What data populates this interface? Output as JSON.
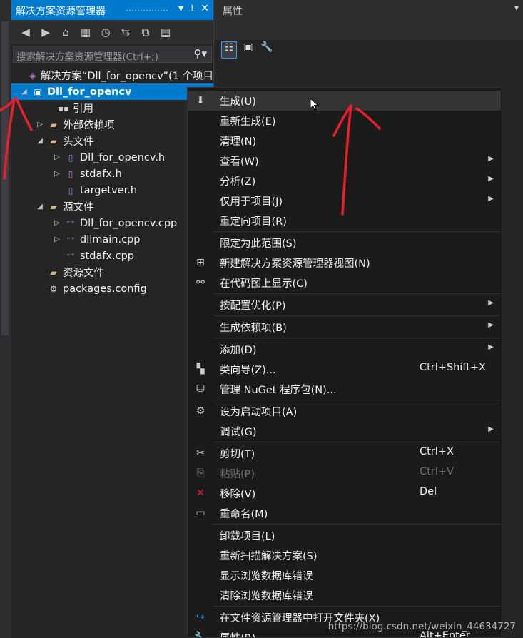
{
  "solution_explorer": {
    "title": "解决方案资源管理器",
    "title_buttons": [
      "▾",
      "⊕",
      "✕"
    ],
    "search_placeholder": "搜索解决方案资源管理器(Ctrl+;)",
    "tree": [
      {
        "label": "解决方案“Dll_for_opencv”(1 个项目",
        "icon": "solution-icon",
        "arrow": ""
      },
      {
        "label": "Dll_for_opencv",
        "icon": "project-icon",
        "arrow": "◢",
        "selected": true
      },
      {
        "label": "引用",
        "icon": "references-icon",
        "arrow": ""
      },
      {
        "label": "外部依赖项",
        "icon": "folder-icon",
        "arrow": "▷"
      },
      {
        "label": "头文件",
        "icon": "folder-icon",
        "arrow": "◢"
      },
      {
        "label": "Dll_for_opencv.h",
        "icon": "header-file-icon",
        "arrow": "▷"
      },
      {
        "label": "stdafx.h",
        "icon": "header-file-icon",
        "arrow": "▷"
      },
      {
        "label": "targetver.h",
        "icon": "header-file-icon",
        "arrow": ""
      },
      {
        "label": "源文件",
        "icon": "folder-icon",
        "arrow": "◢"
      },
      {
        "label": "Dll_for_opencv.cpp",
        "icon": "cpp-file-icon",
        "arrow": "▷"
      },
      {
        "label": "dllmain.cpp",
        "icon": "cpp-file-icon",
        "arrow": "▷"
      },
      {
        "label": "stdafx.cpp",
        "icon": "cpp-file-icon",
        "arrow": ""
      },
      {
        "label": "资源文件",
        "icon": "folder-icon",
        "arrow": ""
      },
      {
        "label": "packages.config",
        "icon": "config-file-icon",
        "arrow": ""
      }
    ]
  },
  "properties": {
    "title": "属性"
  },
  "context_menu": {
    "items": [
      {
        "label": "生成(U)",
        "icon": "build-icon",
        "hot": true
      },
      {
        "label": "重新生成(E)"
      },
      {
        "label": "清理(N)"
      },
      {
        "label": "查看(W)",
        "submenu": true
      },
      {
        "label": "分析(Z)",
        "submenu": true
      },
      {
        "label": "仅用于项目(J)",
        "submenu": true
      },
      {
        "label": "重定向项目(R)"
      },
      {
        "sep": true
      },
      {
        "label": "限定为此范围(S)"
      },
      {
        "label": "新建解决方案资源管理器视图(N)",
        "icon": "new-view-icon"
      },
      {
        "label": "在代码图上显示(C)",
        "icon": "code-map-icon"
      },
      {
        "sep": true
      },
      {
        "label": "按配置优化(P)",
        "submenu": true
      },
      {
        "sep": true
      },
      {
        "label": "生成依赖项(B)",
        "submenu": true
      },
      {
        "sep": true
      },
      {
        "label": "添加(D)",
        "submenu": true
      },
      {
        "label": "类向导(Z)...",
        "icon": "class-wizard-icon",
        "shortcut": "Ctrl+Shift+X"
      },
      {
        "label": "管理 NuGet 程序包(N)...",
        "icon": "nuget-icon"
      },
      {
        "sep": true
      },
      {
        "label": "设为启动项目(A)",
        "icon": "gear-icon"
      },
      {
        "label": "调试(G)",
        "submenu": true
      },
      {
        "sep": true
      },
      {
        "label": "剪切(T)",
        "icon": "scissors-icon",
        "shortcut": "Ctrl+X"
      },
      {
        "label": "粘贴(P)",
        "icon": "paste-icon",
        "shortcut": "Ctrl+V",
        "disabled": true
      },
      {
        "label": "移除(V)",
        "icon": "remove-icon",
        "shortcut": "Del"
      },
      {
        "label": "重命名(M)",
        "icon": "rename-icon"
      },
      {
        "sep": true
      },
      {
        "label": "卸载项目(L)"
      },
      {
        "label": "重新扫描解决方案(S)"
      },
      {
        "label": "显示浏览数据库错误"
      },
      {
        "label": "清除浏览数据库错误"
      },
      {
        "sep": true
      },
      {
        "label": "在文件资源管理器中打开文件夹(X)",
        "icon": "open-folder-icon"
      },
      {
        "label": "属性(R)",
        "icon": "wrench-icon",
        "shortcut": "Alt+Enter"
      }
    ]
  },
  "watermark": "https://blog.csdn.net/weixin_44634727",
  "colors": {
    "accent": "#007acc",
    "annotation": "#e8202a"
  }
}
